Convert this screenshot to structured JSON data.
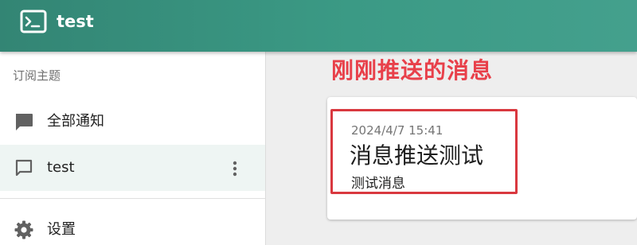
{
  "app": {
    "title": "test"
  },
  "sidebar": {
    "section_label": "订阅主题",
    "items": [
      {
        "label": "全部通知",
        "icon": "chat-bubble-filled-icon"
      },
      {
        "label": "test",
        "icon": "chat-bubble-outline-icon",
        "selected": true
      },
      {
        "label": "设置",
        "icon": "gear-icon"
      }
    ]
  },
  "annotation": {
    "text": "刚刚推送的消息",
    "color": "#e8404a"
  },
  "message": {
    "time": "2024/4/7 15:41",
    "title": "消息推送测试",
    "body": "测试消息"
  },
  "colors": {
    "appbar": "#3b9a85",
    "highlight": "#d9383f",
    "selected_row": "#eef5f3"
  }
}
